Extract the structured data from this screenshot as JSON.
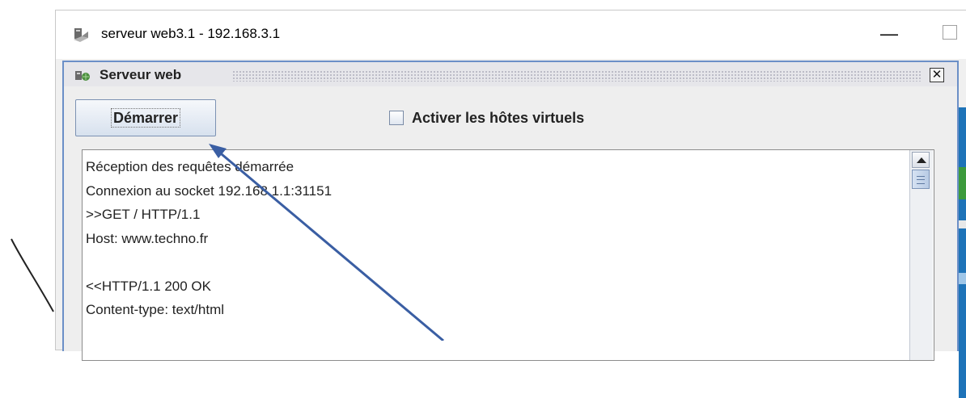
{
  "window": {
    "title": "serveur web3.1 - 192.168.3.1",
    "minimize_glyph": "—"
  },
  "frame": {
    "title": "Serveur web",
    "close_glyph": "✕"
  },
  "controls": {
    "start_label": "Démarrer",
    "virtual_hosts_label": "Activer les hôtes virtuels",
    "virtual_hosts_checked": false
  },
  "log": {
    "lines": [
      "Réception des requêtes démarrée",
      "Connexion au socket 192.168.1.1:31151",
      ">>GET / HTTP/1.1",
      "Host: www.techno.fr",
      "",
      "<<HTTP/1.1 200 OK",
      "Content-type: text/html"
    ]
  },
  "icons": {
    "window_icon": "server-icon",
    "frame_icon": "server-icon",
    "minimize": "minimize-icon",
    "maximize": "maximize-icon",
    "close": "close-icon",
    "scroll_up": "arrow-up-icon"
  },
  "colors": {
    "arrow": "#3a5ea3",
    "frame_border": "#6b8fc7",
    "side_strip": "#1e73b8"
  }
}
